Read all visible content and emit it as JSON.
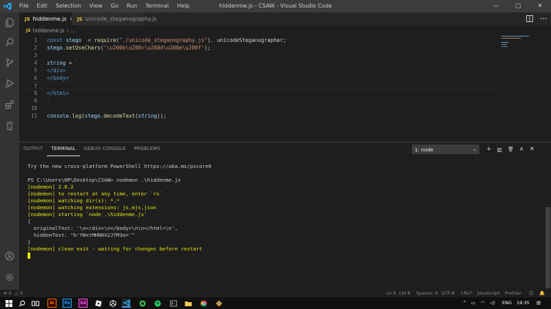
{
  "window": {
    "title": "hiddenme.js - CSAW - Visual Studio Code",
    "menu": [
      "File",
      "Edit",
      "Selection",
      "View",
      "Go",
      "Run",
      "Terminal",
      "Help"
    ],
    "controls": {
      "minimize": "—",
      "maximize": "▢",
      "close": "✕"
    }
  },
  "tabs": [
    {
      "label": "hiddenme.js",
      "badge": "JS",
      "close": "×"
    },
    {
      "label": "unicode_steganography.js",
      "badge": "JS"
    }
  ],
  "breadcrumb": {
    "badge": "JS",
    "file": "hiddenme.js",
    "sep": "›",
    "more": "…"
  },
  "editor": {
    "lines": [
      {
        "n": "1",
        "tokens": [
          [
            "kw",
            "const "
          ],
          [
            "var",
            "stego"
          ],
          [
            "",
            "  = "
          ],
          [
            "fn",
            "require"
          ],
          [
            "",
            "("
          ],
          [
            "str",
            "\"./unicode_steganography.js\""
          ],
          [
            "",
            "). unicodeSteganographer;"
          ]
        ]
      },
      {
        "n": "2",
        "tokens": [
          [
            "var",
            "stego"
          ],
          [
            "",
            "."
          ],
          [
            "fn",
            "setUseChars"
          ],
          [
            "",
            "("
          ],
          [
            "str",
            "'\\u200b\\u200c\\u200d\\u200e\\u200f'"
          ],
          [
            "",
            ");"
          ]
        ]
      },
      {
        "n": "3",
        "tokens": []
      },
      {
        "n": "4",
        "tokens": [
          [
            "var",
            "string"
          ],
          [
            "",
            " = "
          ],
          [
            "str",
            "`"
          ]
        ]
      },
      {
        "n": "5",
        "tokens": [
          [
            "tag",
            "</div>"
          ]
        ]
      },
      {
        "n": "6",
        "tokens": [
          [
            "tag",
            "</body>"
          ]
        ]
      },
      {
        "n": "7",
        "tokens": [],
        "current": true
      },
      {
        "n": "8",
        "tokens": [
          [
            "tag",
            "</html>"
          ]
        ]
      },
      {
        "n": "9",
        "tokens": [
          [
            "str",
            "`"
          ]
        ]
      },
      {
        "n": "10",
        "tokens": []
      },
      {
        "n": "11",
        "tokens": [
          [
            "var",
            "console"
          ],
          [
            "",
            "."
          ],
          [
            "fn",
            "log"
          ],
          [
            "",
            "("
          ],
          [
            "var",
            "stego"
          ],
          [
            "",
            "."
          ],
          [
            "fn",
            "decodeText"
          ],
          [
            "",
            "("
          ],
          [
            "var",
            "string"
          ],
          [
            "",
            "));"
          ]
        ]
      }
    ]
  },
  "panel": {
    "tabs": [
      "OUTPUT",
      "TERMINAL",
      "DEBUG CONSOLE",
      "PROBLEMS"
    ],
    "active_tab": "TERMINAL",
    "terminal_select": "1: node",
    "terminal_chevron": "⌄",
    "actions": {
      "add": "+",
      "split": "▥",
      "trash": "🗑",
      "maximize": "∧",
      "close": "✕"
    },
    "terminal_lines": [
      {
        "text": "Try the new cross-platform PowerShell https://aka.ms/pscore6",
        "kind": "plain"
      },
      {
        "text": "",
        "kind": "plain"
      },
      {
        "text": "PS C:\\Users\\HP\\Desktop\\CSAW> nodemon .\\hiddenme.js",
        "kind": "plain"
      },
      {
        "text": "[nodemon] 2.0.2",
        "kind": "nodemon"
      },
      {
        "text": "[nodemon] to restart at any time, enter `rs`",
        "kind": "nodemon"
      },
      {
        "text": "[nodemon] watching dir(s): *.*",
        "kind": "nodemon"
      },
      {
        "text": "[nodemon] watching extensions: js,mjs,json",
        "kind": "nodemon"
      },
      {
        "text": "[nodemon] starting `node .\\hiddenme.js`",
        "kind": "nodemon"
      },
      {
        "text": "{",
        "kind": "plain"
      },
      {
        "text": "  originalText: '\\n</div>\\n</body>\\n\\n</html>\\n',",
        "kind": "plain"
      },
      {
        "text": "  hiddenText: \"b'YWxtMHN0X2JfM3o='\"",
        "kind": "plain"
      },
      {
        "text": "}",
        "kind": "plain"
      },
      {
        "text": "[nodemon] clean exit - waiting for changes before restart",
        "kind": "nodemon"
      }
    ]
  },
  "status": {
    "errors": "⊗ 0",
    "warnings": "△ 0",
    "position": "Ln 6, Col 8",
    "spaces": "Spaces: 4",
    "encoding": "UTF-8",
    "eol": "CRLF",
    "language": "JavaScript",
    "formatter": "Prettier"
  },
  "taskbar": {
    "apps": [
      {
        "label": "Ai",
        "color": "#ff7c00",
        "bg": "#330000"
      },
      {
        "label": "Ps",
        "color": "#31a8ff",
        "bg": "#001e36"
      },
      {
        "label": "Xd",
        "color": "#ff61f6",
        "bg": "#470137"
      }
    ],
    "language": "ENG",
    "time": "19:35"
  },
  "colors": {
    "accent_vscode_blue": "#007acc",
    "nodemon_yellow": "#e5e510"
  }
}
